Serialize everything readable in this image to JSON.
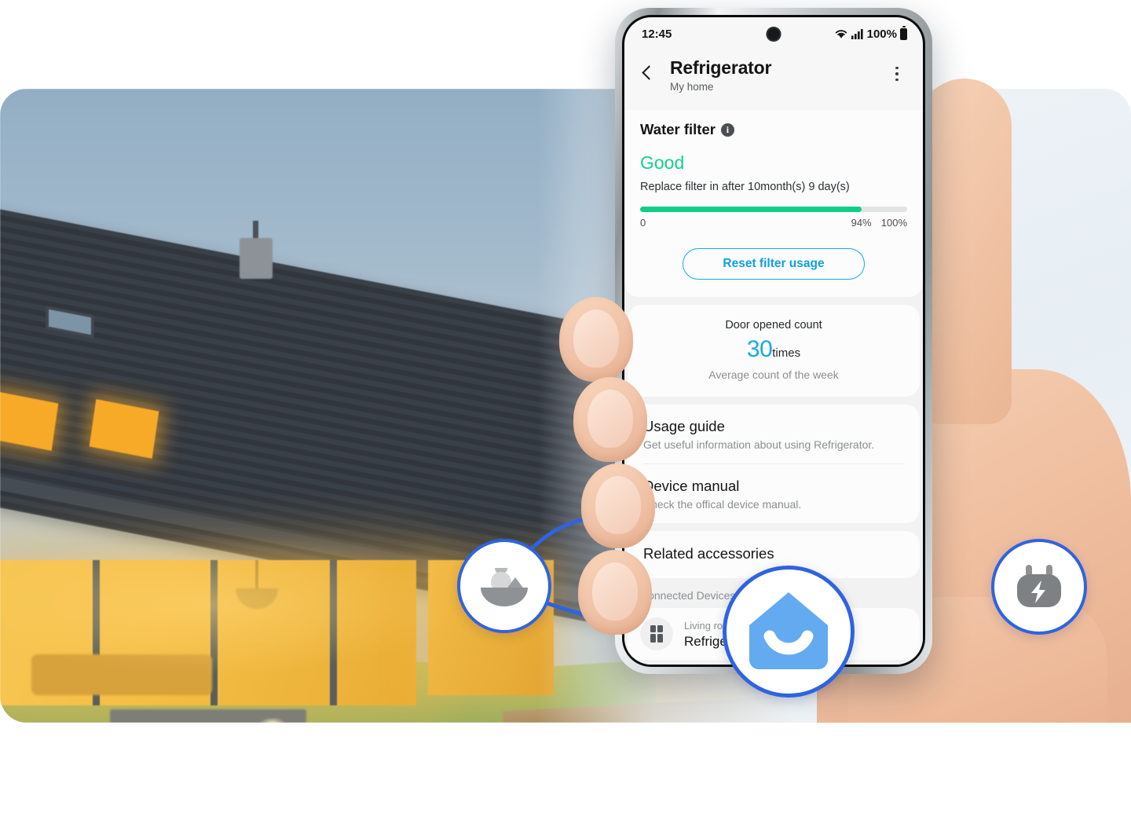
{
  "phone": {
    "statusbar": {
      "time": "12:45",
      "battery_text": "100%",
      "wifi_icon": "wifi-icon",
      "signal_icon": "cellular-signal-icon",
      "battery_icon": "battery-icon",
      "camera_icon": "front-camera-punch-hole"
    },
    "appbar": {
      "back_icon": "back-chevron-icon",
      "title": "Refrigerator",
      "subtitle": "My home",
      "more_icon": "more-options-icon"
    },
    "water_filter": {
      "heading": "Water filter",
      "info_icon": "info-icon",
      "info_glyph": "i",
      "status": "Good",
      "status_color": "#12d18e",
      "description": "Replace filter in after 10month(s) 9 day(s)",
      "progress": {
        "value": 94,
        "min_label": "0",
        "value_label": "94%",
        "max_label": "100%",
        "fill_color": "#0fcf88",
        "track_color": "#e2e3e3"
      },
      "reset_button": "Reset filter usage",
      "reset_button_color": "#0e9fe0"
    },
    "door_opened": {
      "label": "Door opened count",
      "count": "30",
      "unit": "times",
      "sub": "Average count of the week",
      "count_color": "#18a8e8"
    },
    "rows": [
      {
        "title": "Usage guide",
        "sub": "Get useful information about using Refrigerator."
      },
      {
        "title": "Device manual",
        "sub": "Check the offical device manual."
      }
    ],
    "accessories": {
      "title": "Related accessories"
    },
    "connected": {
      "section_label": "Connected Devices",
      "device_icon": "refrigerator-icon",
      "room": "Living room",
      "name": "Refrigerator"
    }
  },
  "badges": [
    {
      "name": "food-bowl-icon",
      "label": "Food",
      "border_color": "#2f63e0"
    },
    {
      "name": "smartthings-home-icon",
      "label": "SmartThings",
      "border_color": "#2f63e0",
      "fill": "#64aaf0"
    },
    {
      "name": "power-plug-icon",
      "label": "Energy",
      "border_color": "#2f63e0"
    }
  ],
  "scene": {
    "background_alt": "Modern house at dusk with warm interior lighting",
    "hand_alt": "Hand holding smartphone",
    "connector_color": "#2f63e0"
  }
}
